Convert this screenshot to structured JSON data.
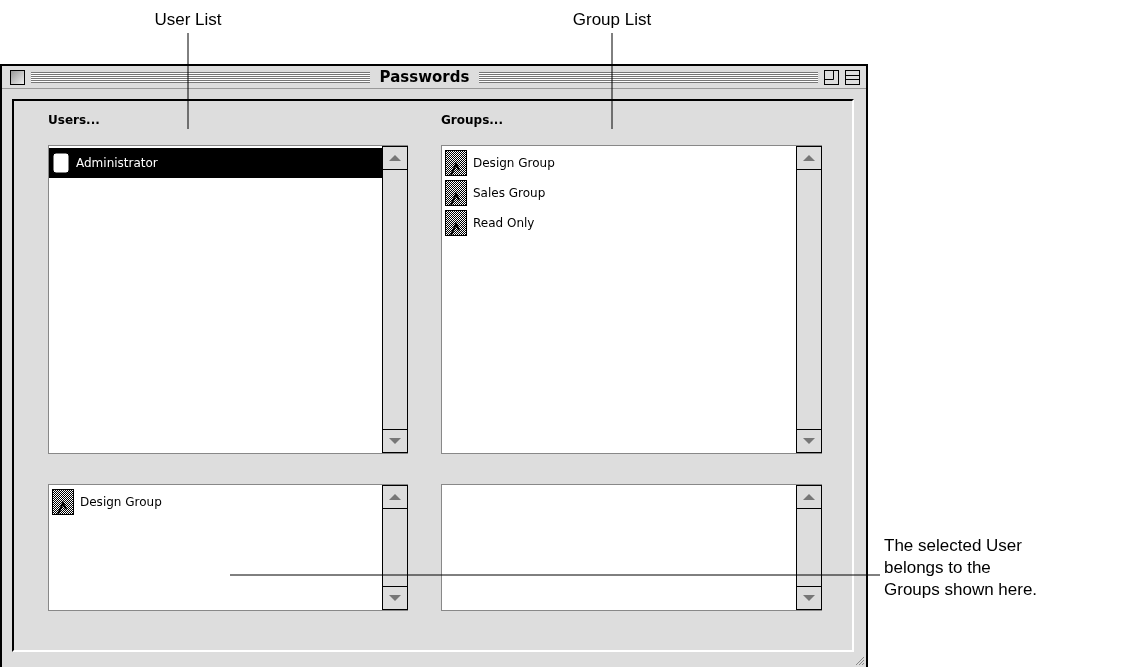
{
  "callouts": [
    {
      "text": "User List",
      "kind": "top"
    },
    {
      "text": "Group List",
      "kind": "top"
    },
    {
      "text": "The selected User\nbelongs to the\nGroups shown here.",
      "kind": "side"
    }
  ],
  "window": {
    "title": "Passwords",
    "columns": [
      {
        "heading": "Users...",
        "list": {
          "items": [
            {
              "label": "Administrator",
              "kind": "user",
              "selected": true
            }
          ]
        },
        "members": {
          "items": [
            {
              "label": "Design Group",
              "kind": "group",
              "selected": false
            }
          ]
        }
      },
      {
        "heading": "Groups...",
        "list": {
          "items": [
            {
              "label": "Design Group",
              "kind": "group",
              "selected": false
            },
            {
              "label": "Sales Group",
              "kind": "group",
              "selected": false
            },
            {
              "label": "Read Only",
              "kind": "group",
              "selected": false
            }
          ]
        }
      }
    ]
  }
}
